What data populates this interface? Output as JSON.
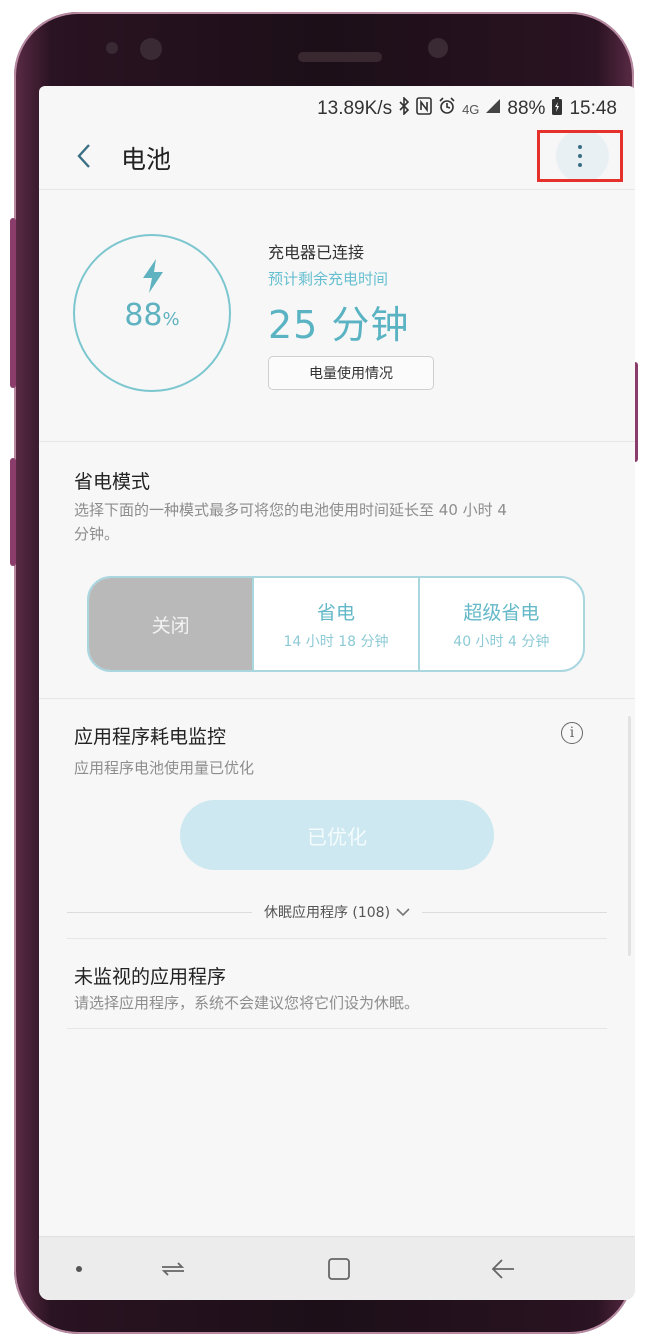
{
  "status_bar": {
    "network_speed": "13.89K/s",
    "signal_label": "4G",
    "battery_percent": "88%",
    "time": "15:48"
  },
  "header": {
    "title": "电池"
  },
  "battery": {
    "level_value": "88",
    "level_unit": "%",
    "charger_status": "充电器已连接",
    "estimate_label": "预计剩余充电时间",
    "remaining_time": "25 分钟",
    "usage_button": "电量使用情况"
  },
  "power_saving": {
    "title": "省电模式",
    "description": "选择下面的一种模式最多可将您的电池使用时间延长至 40 小时 4 分钟。",
    "modes": [
      {
        "name": "关闭",
        "time": "",
        "selected": true
      },
      {
        "name": "省电",
        "time": "14 小时 18 分钟",
        "selected": false
      },
      {
        "name": "超级省电",
        "time": "40 小时 4 分钟",
        "selected": false
      }
    ]
  },
  "app_monitor": {
    "title": "应用程序耗电监控",
    "description": "应用程序电池使用量已优化",
    "optimized_button": "已优化",
    "sleeping_apps": "休眠应用程序 (108)"
  },
  "unmonitored": {
    "title": "未监视的应用程序",
    "description": "请选择应用程序，系统不会建议您将它们设为休眠。"
  },
  "colors": {
    "accent": "#5ab3c3",
    "highlight_box": "#e5312b",
    "phone_frame": "#5b2b46"
  }
}
